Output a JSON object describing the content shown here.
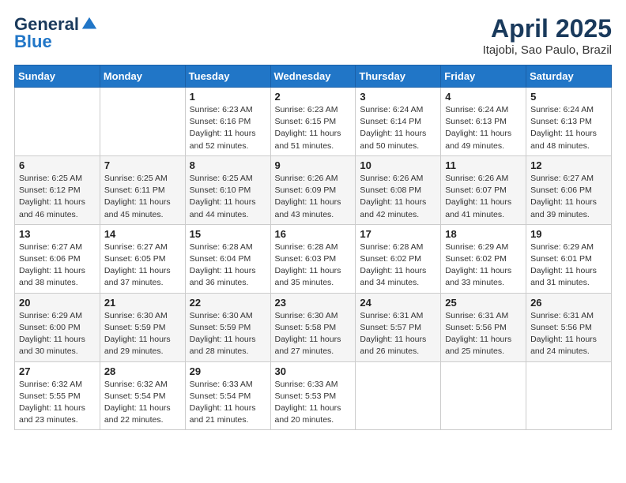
{
  "header": {
    "logo_general": "General",
    "logo_blue": "Blue",
    "month": "April 2025",
    "location": "Itajobi, Sao Paulo, Brazil"
  },
  "weekdays": [
    "Sunday",
    "Monday",
    "Tuesday",
    "Wednesday",
    "Thursday",
    "Friday",
    "Saturday"
  ],
  "weeks": [
    [
      {
        "day": "",
        "info": ""
      },
      {
        "day": "",
        "info": ""
      },
      {
        "day": "1",
        "info": "Sunrise: 6:23 AM\nSunset: 6:16 PM\nDaylight: 11 hours and 52 minutes."
      },
      {
        "day": "2",
        "info": "Sunrise: 6:23 AM\nSunset: 6:15 PM\nDaylight: 11 hours and 51 minutes."
      },
      {
        "day": "3",
        "info": "Sunrise: 6:24 AM\nSunset: 6:14 PM\nDaylight: 11 hours and 50 minutes."
      },
      {
        "day": "4",
        "info": "Sunrise: 6:24 AM\nSunset: 6:13 PM\nDaylight: 11 hours and 49 minutes."
      },
      {
        "day": "5",
        "info": "Sunrise: 6:24 AM\nSunset: 6:13 PM\nDaylight: 11 hours and 48 minutes."
      }
    ],
    [
      {
        "day": "6",
        "info": "Sunrise: 6:25 AM\nSunset: 6:12 PM\nDaylight: 11 hours and 46 minutes."
      },
      {
        "day": "7",
        "info": "Sunrise: 6:25 AM\nSunset: 6:11 PM\nDaylight: 11 hours and 45 minutes."
      },
      {
        "day": "8",
        "info": "Sunrise: 6:25 AM\nSunset: 6:10 PM\nDaylight: 11 hours and 44 minutes."
      },
      {
        "day": "9",
        "info": "Sunrise: 6:26 AM\nSunset: 6:09 PM\nDaylight: 11 hours and 43 minutes."
      },
      {
        "day": "10",
        "info": "Sunrise: 6:26 AM\nSunset: 6:08 PM\nDaylight: 11 hours and 42 minutes."
      },
      {
        "day": "11",
        "info": "Sunrise: 6:26 AM\nSunset: 6:07 PM\nDaylight: 11 hours and 41 minutes."
      },
      {
        "day": "12",
        "info": "Sunrise: 6:27 AM\nSunset: 6:06 PM\nDaylight: 11 hours and 39 minutes."
      }
    ],
    [
      {
        "day": "13",
        "info": "Sunrise: 6:27 AM\nSunset: 6:06 PM\nDaylight: 11 hours and 38 minutes."
      },
      {
        "day": "14",
        "info": "Sunrise: 6:27 AM\nSunset: 6:05 PM\nDaylight: 11 hours and 37 minutes."
      },
      {
        "day": "15",
        "info": "Sunrise: 6:28 AM\nSunset: 6:04 PM\nDaylight: 11 hours and 36 minutes."
      },
      {
        "day": "16",
        "info": "Sunrise: 6:28 AM\nSunset: 6:03 PM\nDaylight: 11 hours and 35 minutes."
      },
      {
        "day": "17",
        "info": "Sunrise: 6:28 AM\nSunset: 6:02 PM\nDaylight: 11 hours and 34 minutes."
      },
      {
        "day": "18",
        "info": "Sunrise: 6:29 AM\nSunset: 6:02 PM\nDaylight: 11 hours and 33 minutes."
      },
      {
        "day": "19",
        "info": "Sunrise: 6:29 AM\nSunset: 6:01 PM\nDaylight: 11 hours and 31 minutes."
      }
    ],
    [
      {
        "day": "20",
        "info": "Sunrise: 6:29 AM\nSunset: 6:00 PM\nDaylight: 11 hours and 30 minutes."
      },
      {
        "day": "21",
        "info": "Sunrise: 6:30 AM\nSunset: 5:59 PM\nDaylight: 11 hours and 29 minutes."
      },
      {
        "day": "22",
        "info": "Sunrise: 6:30 AM\nSunset: 5:59 PM\nDaylight: 11 hours and 28 minutes."
      },
      {
        "day": "23",
        "info": "Sunrise: 6:30 AM\nSunset: 5:58 PM\nDaylight: 11 hours and 27 minutes."
      },
      {
        "day": "24",
        "info": "Sunrise: 6:31 AM\nSunset: 5:57 PM\nDaylight: 11 hours and 26 minutes."
      },
      {
        "day": "25",
        "info": "Sunrise: 6:31 AM\nSunset: 5:56 PM\nDaylight: 11 hours and 25 minutes."
      },
      {
        "day": "26",
        "info": "Sunrise: 6:31 AM\nSunset: 5:56 PM\nDaylight: 11 hours and 24 minutes."
      }
    ],
    [
      {
        "day": "27",
        "info": "Sunrise: 6:32 AM\nSunset: 5:55 PM\nDaylight: 11 hours and 23 minutes."
      },
      {
        "day": "28",
        "info": "Sunrise: 6:32 AM\nSunset: 5:54 PM\nDaylight: 11 hours and 22 minutes."
      },
      {
        "day": "29",
        "info": "Sunrise: 6:33 AM\nSunset: 5:54 PM\nDaylight: 11 hours and 21 minutes."
      },
      {
        "day": "30",
        "info": "Sunrise: 6:33 AM\nSunset: 5:53 PM\nDaylight: 11 hours and 20 minutes."
      },
      {
        "day": "",
        "info": ""
      },
      {
        "day": "",
        "info": ""
      },
      {
        "day": "",
        "info": ""
      }
    ]
  ]
}
